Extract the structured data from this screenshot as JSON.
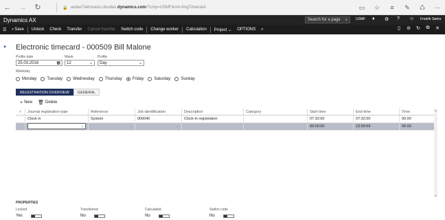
{
  "browser": {
    "url_pre": "axdax7demoaos.cloudax.",
    "url_domain": "dynamics.com",
    "url_post": "/?cmp=USMF&mi=JmgTimecard"
  },
  "app": {
    "title": "Dynamics AX",
    "search_placeholder": "Search for a page",
    "company": "USMF",
    "user": "Fredrik Sætre"
  },
  "actions": [
    "Save",
    "Unlock",
    "Check",
    "Transfer",
    "Cancel transfer",
    "Switch code",
    "Change worker",
    "Calculation",
    "Project",
    "OPTIONS"
  ],
  "page": {
    "title": "Electronic timecard - 000509 Bill Malone",
    "profile_date_label": "Profile date",
    "profile_date": "25.03.2016",
    "week_label": "Week",
    "week": "12",
    "profile_label": "Profile",
    "profile": "Day",
    "weekday_label": "Weekday",
    "weekdays": [
      "Monday",
      "Tuesday",
      "Wednesday",
      "Thursday",
      "Friday",
      "Saturday",
      "Sunday"
    ],
    "selected_weekday": "Friday"
  },
  "tabs": [
    "REGISTRATION OVERVIEW",
    "GENERAL"
  ],
  "grid_toolbar": {
    "new": "New",
    "delete": "Delete"
  },
  "grid": {
    "columns": [
      "Journal registration type",
      "Reference",
      "Job identification",
      "Description",
      "Category",
      "Start time",
      "End time",
      "Time"
    ],
    "rows": [
      [
        "Clock in",
        "System",
        "000040",
        "Clock-in registration",
        "",
        "07:32:00",
        "07:32:00",
        "00.00"
      ],
      [
        "",
        "",
        "",
        "",
        "",
        "00:00:00",
        "23:59:59",
        "00.00"
      ]
    ]
  },
  "properties": {
    "title": "PROPERTIES",
    "items": [
      {
        "label": "Locked",
        "value": "Yes"
      },
      {
        "label": "Transferred",
        "value": "No"
      },
      {
        "label": "Calculated",
        "value": "No"
      },
      {
        "label": "Switch code",
        "value": "No"
      }
    ]
  }
}
